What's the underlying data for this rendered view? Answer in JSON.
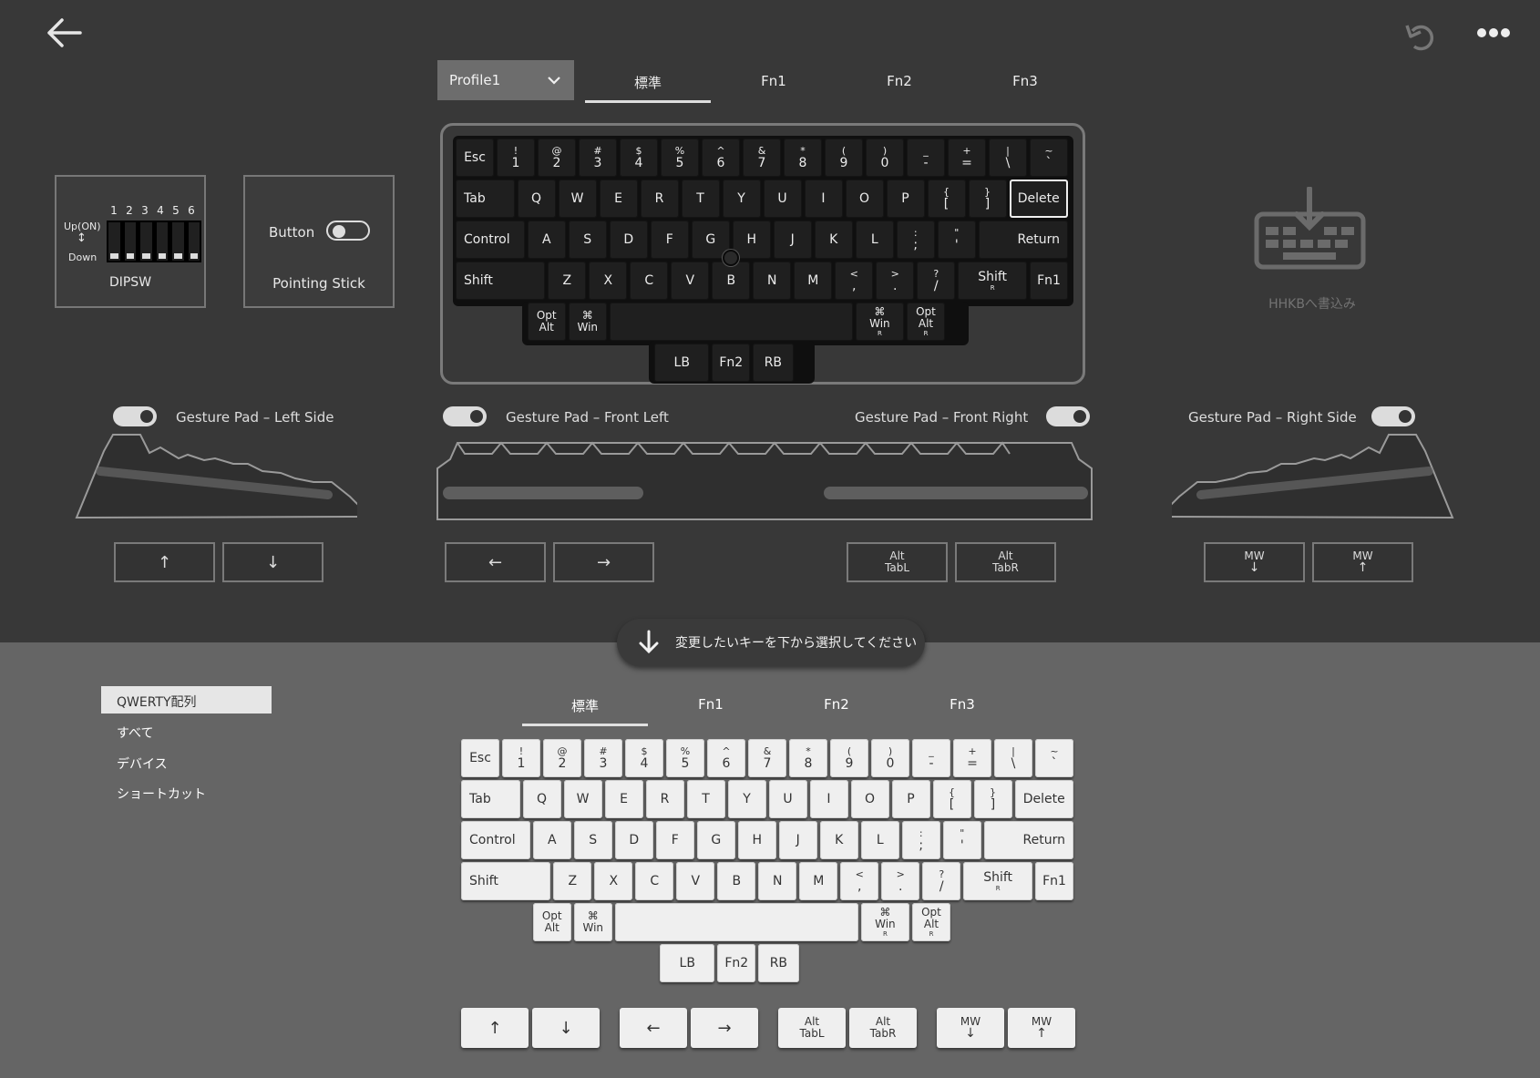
{
  "header": {
    "back_icon": "arrow-left-icon",
    "undo_icon": "undo-icon",
    "more_icon": "more-dots-icon"
  },
  "profile": {
    "selected": "Profile1"
  },
  "layer_tabs": [
    "標準",
    "Fn1",
    "Fn2",
    "Fn3"
  ],
  "dipsw": {
    "numbers": [
      "1",
      "2",
      "3",
      "4",
      "5",
      "6"
    ],
    "up_label": "Up(ON)",
    "down_label": "Down",
    "title": "DIPSW"
  },
  "pointing": {
    "button_label": "Button",
    "title": "Pointing Stick"
  },
  "write": {
    "label": "HHKBへ書込み",
    "icon": "keyboard-download-icon"
  },
  "gesture": {
    "left_side": {
      "label": "Gesture Pad – Left Side",
      "buttons": [
        {
          "top": "↑",
          "sub": ""
        },
        {
          "top": "↓",
          "sub": ""
        }
      ]
    },
    "front_left": {
      "label": "Gesture Pad – Front Left",
      "buttons": [
        {
          "top": "←",
          "sub": ""
        },
        {
          "top": "→",
          "sub": ""
        }
      ]
    },
    "front_right": {
      "label": "Gesture Pad – Front Right",
      "buttons": [
        {
          "top": "Alt",
          "sub": "TabL"
        },
        {
          "top": "Alt",
          "sub": "TabR"
        }
      ]
    },
    "right_side": {
      "label": "Gesture Pad – Right Side",
      "buttons": [
        {
          "top": "MW",
          "sub": "↓"
        },
        {
          "top": "MW",
          "sub": "↑"
        }
      ]
    }
  },
  "prompt": {
    "text": "変更したいキーを下から選択してください",
    "icon": "arrow-down-icon"
  },
  "sidebar": {
    "items": [
      "QWERTY配列",
      "すべて",
      "デバイス",
      "ショートカット"
    ]
  },
  "lower_tabs": [
    "標準",
    "Fn1",
    "Fn2",
    "Fn3"
  ],
  "keyboard": {
    "rows": [
      [
        [
          "Esc",
          ""
        ],
        [
          "!",
          "1"
        ],
        [
          "@",
          "2"
        ],
        [
          "#",
          "3"
        ],
        [
          "$",
          "4"
        ],
        [
          "%",
          "5"
        ],
        [
          "^",
          "6"
        ],
        [
          "&",
          "7"
        ],
        [
          "*",
          "8"
        ],
        [
          "(",
          "9"
        ],
        [
          ")",
          "0"
        ],
        [
          "_",
          "-"
        ],
        [
          "+",
          "="
        ],
        [
          "|",
          "\\"
        ],
        [
          "~",
          "`"
        ]
      ],
      [
        [
          "Tab",
          ""
        ],
        [
          "Q",
          ""
        ],
        [
          "W",
          ""
        ],
        [
          "E",
          ""
        ],
        [
          "R",
          ""
        ],
        [
          "T",
          ""
        ],
        [
          "Y",
          ""
        ],
        [
          "U",
          ""
        ],
        [
          "I",
          ""
        ],
        [
          "O",
          ""
        ],
        [
          "P",
          ""
        ],
        [
          "{",
          "["
        ],
        [
          "}",
          "]"
        ],
        [
          "Delete",
          ""
        ]
      ],
      [
        [
          "Control",
          ""
        ],
        [
          "A",
          ""
        ],
        [
          "S",
          ""
        ],
        [
          "D",
          ""
        ],
        [
          "F",
          ""
        ],
        [
          "G",
          ""
        ],
        [
          "H",
          ""
        ],
        [
          "J",
          ""
        ],
        [
          "K",
          ""
        ],
        [
          "L",
          ""
        ],
        [
          ":",
          ";"
        ],
        [
          "\"",
          "'"
        ],
        [
          "Return",
          ""
        ]
      ],
      [
        [
          "Shift",
          ""
        ],
        [
          "Z",
          ""
        ],
        [
          "X",
          ""
        ],
        [
          "C",
          ""
        ],
        [
          "V",
          ""
        ],
        [
          "B",
          ""
        ],
        [
          "N",
          ""
        ],
        [
          "M",
          ""
        ],
        [
          "<",
          ","
        ],
        [
          ">",
          "."
        ],
        [
          "?",
          "/"
        ],
        [
          "Shift",
          "R"
        ],
        [
          "Fn1",
          ""
        ]
      ],
      [
        [
          "Opt",
          "Alt"
        ],
        [
          "⌘",
          "Win"
        ],
        [
          "",
          ""
        ],
        [
          "⌘",
          "Win",
          "R"
        ],
        [
          "Opt",
          "Alt",
          "R"
        ]
      ],
      [
        [
          "LB",
          ""
        ],
        [
          "Fn2",
          ""
        ],
        [
          "RB",
          ""
        ]
      ]
    ]
  },
  "lower_extra_keys": [
    {
      "top": "↑",
      "sub": ""
    },
    {
      "top": "↓",
      "sub": ""
    },
    {
      "top": "←",
      "sub": ""
    },
    {
      "top": "→",
      "sub": ""
    },
    {
      "top": "Alt",
      "sub": "TabL"
    },
    {
      "top": "Alt",
      "sub": "TabR"
    },
    {
      "top": "MW",
      "sub": "↓"
    },
    {
      "top": "MW",
      "sub": "↑"
    }
  ]
}
